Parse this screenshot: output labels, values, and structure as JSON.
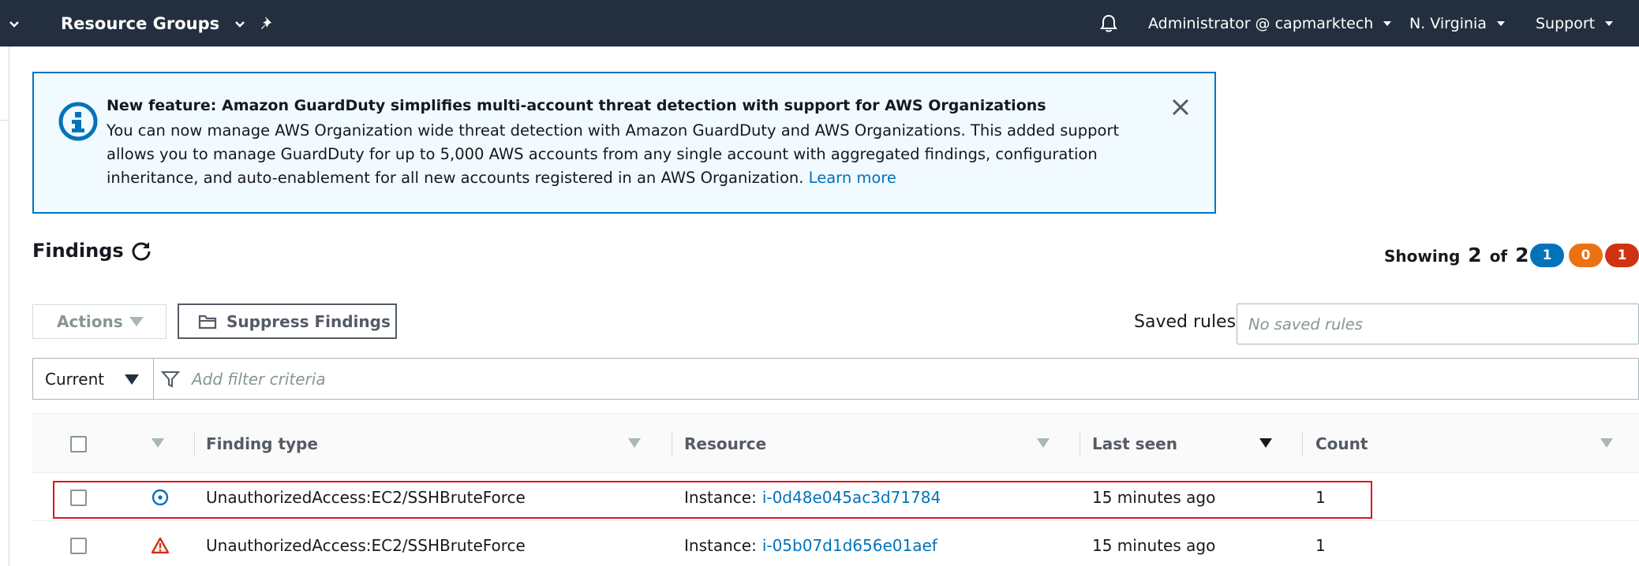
{
  "topnav": {
    "resource_groups": "Resource Groups",
    "account": "Administrator @ capmarktech",
    "region": "N. Virginia",
    "support": "Support",
    "icons": {
      "pin": "pin-icon",
      "bell": "bell-icon"
    },
    "bg_color": "#232f3e"
  },
  "banner": {
    "title": "New feature: Amazon GuardDuty simplifies multi-account threat detection with support for AWS Organizations",
    "body": "You can now manage AWS Organization wide threat detection with Amazon GuardDuty and AWS Organizations. This added support allows you to manage GuardDuty for up to 5,000 AWS accounts from any single account with aggregated findings, configuration inheritance, and auto-enablement for all new accounts registered in an AWS Organization.",
    "link": "Learn more",
    "icon": "info-icon",
    "accent_color": "#0073bb"
  },
  "findings": {
    "title": "Findings",
    "showing_label": "Showing",
    "showing_count": "2",
    "of_label": "of",
    "total_count": "2",
    "severity_badges": [
      {
        "value": "1",
        "color": "#0073bb"
      },
      {
        "value": "0",
        "color": "#ec7211"
      },
      {
        "value": "1",
        "color": "#d13212"
      }
    ]
  },
  "toolbar": {
    "actions_label": "Actions",
    "suppress_label": "Suppress Findings",
    "saved_rules_label": "Saved rules",
    "saved_rules_placeholder": "No saved rules"
  },
  "filter": {
    "selected": "Current",
    "placeholder": "Add filter criteria"
  },
  "table": {
    "columns": [
      "Finding type",
      "Resource",
      "Last seen",
      "Count"
    ],
    "rows": [
      {
        "severity": "low",
        "severity_color": "#0073bb",
        "finding_type": "UnauthorizedAccess:EC2/SSHBruteForce",
        "resource_prefix": "Instance:",
        "resource_id": "i-0d48e045ac3d71784",
        "last_seen": "15 minutes ago",
        "count": "1"
      },
      {
        "severity": "high",
        "severity_color": "#d13212",
        "finding_type": "UnauthorizedAccess:EC2/SSHBruteForce",
        "resource_prefix": "Instance:",
        "resource_id": "i-05b07d1d656e01aef",
        "last_seen": "15 minutes ago",
        "count": "1"
      }
    ]
  }
}
